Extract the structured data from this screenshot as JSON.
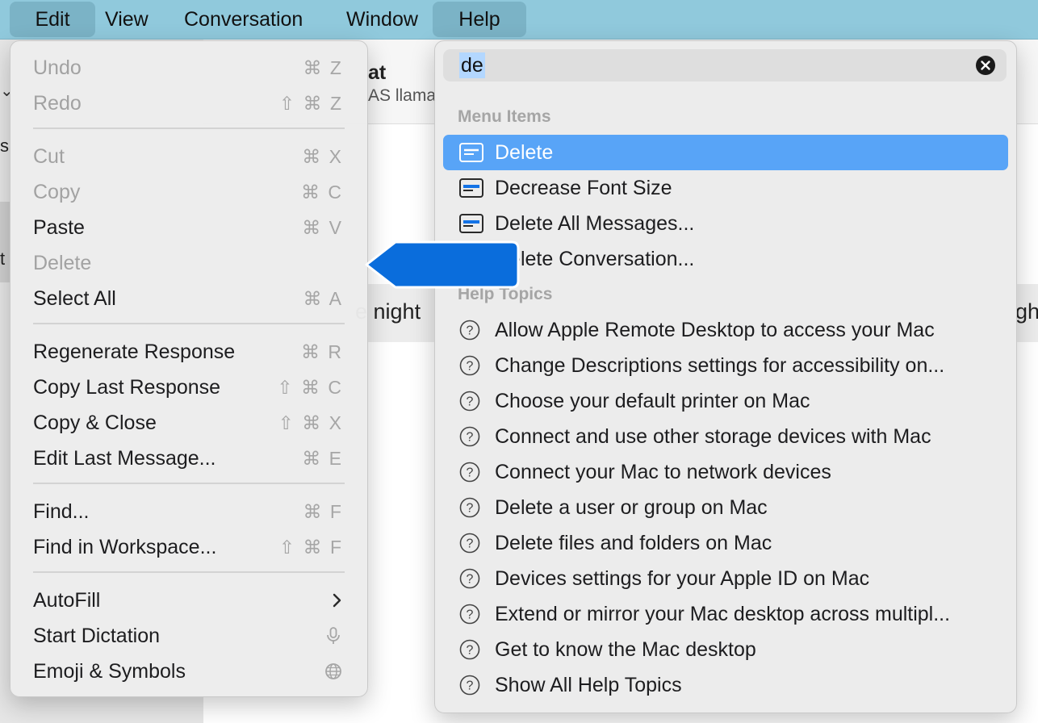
{
  "menubar": {
    "items": [
      "Edit",
      "View",
      "Conversation",
      "Window",
      "Help"
    ]
  },
  "background": {
    "title_fragment": "at",
    "subtitle_fragment": "AS llama",
    "msg_fragment_left": "e night",
    "msg_fragment_right": "ght",
    "left_frag_s": "s",
    "left_frag_t": "t"
  },
  "edit_menu": {
    "items": [
      {
        "label": "Undo",
        "shortcut": "⌘ Z",
        "enabled": false
      },
      {
        "label": "Redo",
        "shortcut": "⇧ ⌘ Z",
        "enabled": false
      },
      {
        "label": "Cut",
        "shortcut": "⌘ X",
        "enabled": false
      },
      {
        "label": "Copy",
        "shortcut": "⌘ C",
        "enabled": false
      },
      {
        "label": "Paste",
        "shortcut": "⌘ V",
        "enabled": true
      },
      {
        "label": "Delete",
        "shortcut": "",
        "enabled": false
      },
      {
        "label": "Select All",
        "shortcut": "⌘ A",
        "enabled": true
      },
      {
        "label": "Regenerate Response",
        "shortcut": "⌘ R",
        "enabled": true
      },
      {
        "label": "Copy Last Response",
        "shortcut": "⇧ ⌘ C",
        "enabled": true
      },
      {
        "label": "Copy & Close",
        "shortcut": "⇧ ⌘ X",
        "enabled": true
      },
      {
        "label": "Edit Last Message...",
        "shortcut": "⌘ E",
        "enabled": true
      },
      {
        "label": "Find...",
        "shortcut": "⌘ F",
        "enabled": true
      },
      {
        "label": "Find in Workspace...",
        "shortcut": "⇧ ⌘ F",
        "enabled": true
      },
      {
        "label": "AutoFill",
        "shortcut": "",
        "enabled": true,
        "icon": "chevron-right-icon"
      },
      {
        "label": "Start Dictation",
        "shortcut": "",
        "enabled": true,
        "icon": "microphone-icon"
      },
      {
        "label": "Emoji & Symbols",
        "shortcut": "",
        "enabled": true,
        "icon": "globe-icon"
      }
    ]
  },
  "help_menu": {
    "search_value": "de",
    "menu_items_heading": "Menu Items",
    "help_topics_heading": "Help Topics",
    "menu_items": [
      "Delete",
      "Decrease Font Size",
      "Delete All Messages...",
      "Delete Conversation..."
    ],
    "selected_menu_item": "Delete",
    "help_topics": [
      "Allow Apple Remote Desktop to access your Mac",
      "Change Descriptions settings for accessibility on...",
      "Choose your default printer on Mac",
      "Connect and use other storage devices with Mac",
      "Connect your Mac to network devices",
      "Delete a user or group on Mac",
      "Delete files and folders on Mac",
      "Devices settings for your Apple ID on Mac",
      "Extend or mirror your Mac desktop across multipl...",
      "Get to know the Mac desktop",
      "Show All Help Topics"
    ]
  },
  "colors": {
    "menubar_bg": "#90c9dc",
    "selection_blue": "#58a4f7",
    "callout_blue": "#0a6ddc"
  }
}
